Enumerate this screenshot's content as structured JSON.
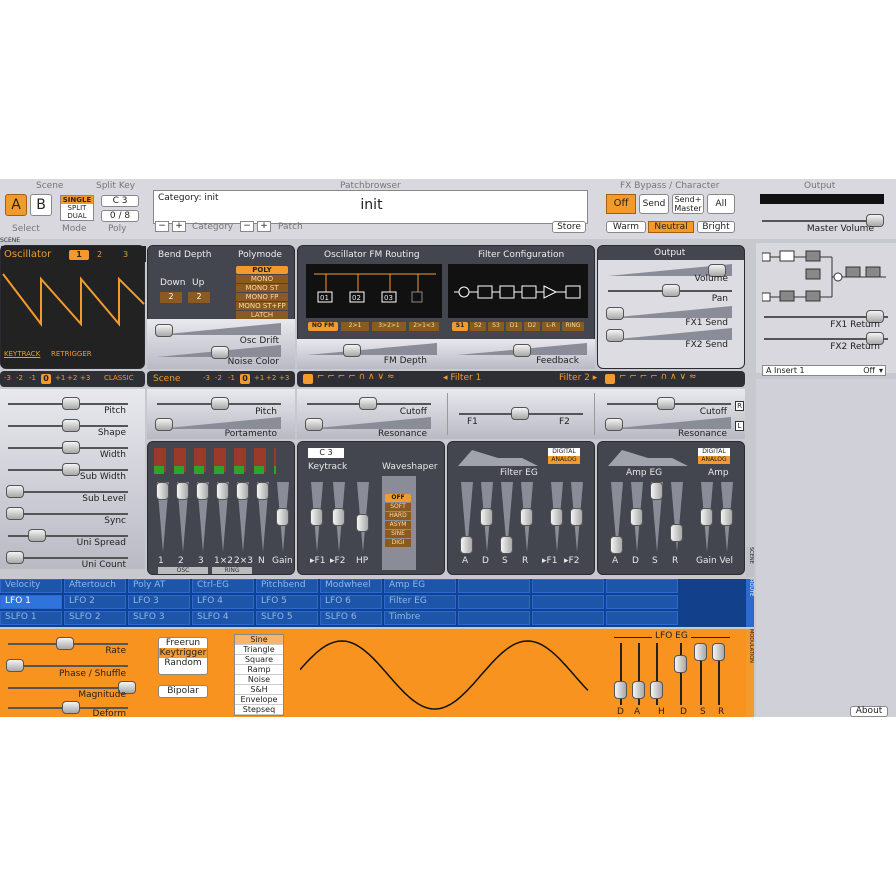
{
  "header": {
    "scene_label": "Scene",
    "a_label": "A",
    "b_label": "B",
    "mode_opts": [
      "SINGLE",
      "SPLIT",
      "DUAL"
    ],
    "split_key_label": "Split Key",
    "split_key_value": "C 3",
    "poly_value": "0 / 8",
    "select_label": "Select",
    "mode_label": "Mode",
    "poly_label": "Poly",
    "patchbrowser_label": "Patchbrowser",
    "category_text": "Category: init",
    "patch_name": "init",
    "category_label": "Category",
    "patch_label": "Patch",
    "store_label": "Store",
    "fx_label": "FX Bypass / Character",
    "fx_off": "Off",
    "fx_send": "Send",
    "fx_send_master": "Send+\nMaster",
    "fx_all": "All",
    "char_warm": "Warm",
    "char_neutral": "Neutral",
    "char_bright": "Bright",
    "output_label": "Output",
    "master_volume": "Master Volume",
    "scene_tag": "SCENE"
  },
  "oscillator": {
    "title": "Oscillator",
    "nums": [
      "1",
      "2",
      "3"
    ],
    "keytrack": "KEYTRACK",
    "retrigger": "RETRIGGER",
    "octaves": [
      "-3",
      "-2",
      "-1",
      "0",
      "+1",
      "+2",
      "+3"
    ],
    "type": "CLASSIC",
    "sliders": [
      "Pitch",
      "Shape",
      "Width",
      "Sub Width",
      "Sub Level",
      "Sync",
      "Uni Spread",
      "Uni Count"
    ]
  },
  "bend": {
    "title": "Bend Depth",
    "down": "Down",
    "up": "Up",
    "down_val": "2",
    "up_val": "2",
    "osc_drift": "Osc Drift",
    "noise_color": "Noise Color"
  },
  "polymode": {
    "title": "Polymode",
    "items": [
      "POLY",
      "MONO",
      "MONO ST",
      "MONO FP",
      "MONO ST+FP",
      "LATCH"
    ]
  },
  "fm": {
    "title": "Oscillator FM Routing",
    "depth": "FM Depth",
    "routes": [
      "NO FM",
      "2>1",
      "3>2>1",
      "2>1<3"
    ],
    "nodes": [
      "01",
      "02",
      "03"
    ]
  },
  "filtercfg": {
    "title": "Filter Configuration",
    "feedback": "Feedback",
    "routes": [
      "S1",
      "S2",
      "S3",
      "D1",
      "D2",
      "L-R",
      "RING"
    ]
  },
  "output": {
    "title": "Output",
    "volume": "Volume",
    "pan": "Pan",
    "fx1": "FX1 Send",
    "fx2": "FX2 Send"
  },
  "scene": {
    "title": "Scene",
    "octaves": [
      "-3",
      "-2",
      "-1",
      "0",
      "+1",
      "+2",
      "+3"
    ],
    "pitch": "Pitch",
    "portamento": "Portamento"
  },
  "filter1": {
    "title": "Filter 1",
    "cutoff": "Cutoff",
    "resonance": "Resonance",
    "f1": "F1",
    "f2": "F2"
  },
  "filter2": {
    "title": "Filter 2",
    "cutoff": "Cutoff",
    "resonance": "Resonance"
  },
  "mixer": {
    "labels": [
      "1",
      "2",
      "3",
      "1×2",
      "2×3",
      "N",
      "Gain"
    ],
    "tags": [
      "OSC",
      "RING"
    ]
  },
  "keytrack": {
    "note": "C 3",
    "title": "Keytrack",
    "labels": [
      "▸F1",
      "▸F2",
      "HP"
    ]
  },
  "waveshaper": {
    "title": "Waveshaper",
    "types": [
      "OFF",
      "SOFT",
      "HARD",
      "ASYM",
      "SINE",
      "DIGI"
    ]
  },
  "filter_eg": {
    "title": "Filter EG",
    "labels": [
      "A",
      "D",
      "S",
      "R",
      "▸F1",
      "▸F2"
    ],
    "mode": [
      "DIGITAL",
      "ANALOG"
    ]
  },
  "amp_eg": {
    "title": "Amp EG",
    "amp": "Amp",
    "labels": [
      "A",
      "D",
      "S",
      "R",
      "Gain Vel"
    ],
    "mode": [
      "DIGITAL",
      "ANALOG"
    ]
  },
  "modrow": {
    "row1": [
      "Velocity",
      "Aftertouch",
      "Poly AT",
      "Ctrl-EG",
      "Pitchbend",
      "Modwheel",
      "Amp EG"
    ],
    "row2": [
      "LFO 1",
      "LFO 2",
      "LFO 3",
      "LFO 4",
      "LFO 5",
      "LFO 6",
      "Filter EG"
    ],
    "row3": [
      "SLFO 1",
      "SLFO 2",
      "SLFO 3",
      "SLFO 4",
      "SLFO 5",
      "SLFO 6",
      "Timbre"
    ]
  },
  "routing": {
    "insert": "A Insert 1",
    "insert_val": "Off",
    "fx1_return": "FX1 Return",
    "fx2_return": "FX2 Return"
  },
  "lfo": {
    "rate": "Rate",
    "phase": "Phase / Shuffle",
    "magnitude": "Magnitude",
    "deform": "Deform",
    "trig": [
      "Freerun",
      "Keytrigger",
      "Random"
    ],
    "bipolar": "Bipolar",
    "shapes": [
      "Sine",
      "Triangle",
      "Square",
      "Ramp",
      "Noise",
      "S&H",
      "Envelope",
      "Stepseq"
    ],
    "eg_title": "LFO EG",
    "eg_labels": [
      "D",
      "A",
      "H",
      "D",
      "S",
      "R"
    ]
  },
  "side_tags": [
    "SCENE",
    "ROUTE",
    "MODULATION"
  ],
  "about": "About"
}
